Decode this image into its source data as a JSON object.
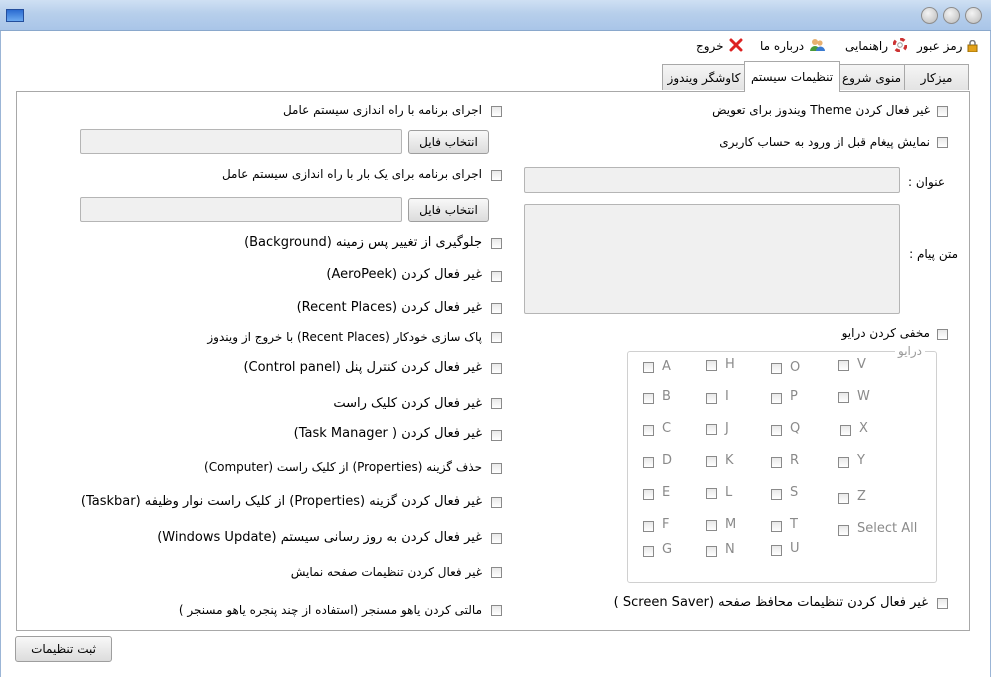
{
  "menu": {
    "password": "رمز عبور",
    "help": "راهنمایی",
    "about": "درباره ما",
    "exit": "خروج"
  },
  "tabs": [
    "میزکار",
    "منوی شروع",
    "تنظیمات سیستم",
    "کاوشگر ویندوز"
  ],
  "right": {
    "disable_theme": "غیر فعال کردن Theme  ویندوز برای تعویض",
    "show_message": "نمایش پیغام قبل از ورود به حساب کاربری",
    "title_label": "عنوان :",
    "message_label": "متن پیام :",
    "hide_drive": "مخفی کردن درایو",
    "drives_caption": "درایو",
    "drives": [
      "A",
      "H",
      "O",
      "V",
      "B",
      "I",
      "P",
      "W",
      "C",
      "J",
      "Q",
      "X",
      "D",
      "K",
      "R",
      "Y",
      "E",
      "L",
      "S",
      "Z",
      "F",
      "M",
      "T",
      "G",
      "N",
      "U"
    ],
    "select_all": "Select All",
    "disable_screensaver": "غیر فعال کردن تنظیمات محافظ صفحه (Screen Saver )"
  },
  "left": {
    "run_at_startup": "اجرای برنامه با راه اندازی سیستم عامل",
    "choose_file": "انتخاب فایل",
    "run_once": "اجرای برنامه برای یک بار با راه اندازی سیستم عامل",
    "options": [
      "جلوگیری از تغییر پس زمینه (Background)",
      "غیر فعال کردن (AeroPeek)",
      "غیر فعال کردن (Recent Places)",
      "پاک سازی خودکار (Recent Places) با خروج از ویندوز",
      "غیر فعال کردن کنترل پنل (Control panel)",
      "غیر فعال کردن کلیک راست",
      "غیر فعال کردن ( Task Manager)",
      "حذف گزینه (Properties) از کلیک راست (Computer)",
      "غیر فعال کردن گزینه (Properties) از کلیک راست نوار وظیفه (Taskbar)",
      "غیر فعال کردن به روز رسانی سیستم (Windows Update)",
      "غیر فعال کردن تنظیمات صفحه نمایش",
      "مالتی کردن یاهو مسنجر (استفاده از چند پنجره یاهو مسنجر )"
    ]
  },
  "footer": {
    "save": "ثبت تنظیمات"
  }
}
